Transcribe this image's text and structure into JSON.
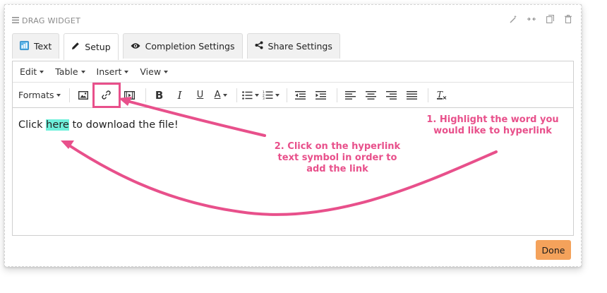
{
  "widget": {
    "title": "DRAG WIDGET",
    "actions": [
      "wand-icon",
      "collapse-icon",
      "copy-icon",
      "trash-icon"
    ]
  },
  "tabs": [
    {
      "label": "Text",
      "icon": "text-icon",
      "active": false
    },
    {
      "label": "Setup",
      "icon": "pencil-icon",
      "active": true
    },
    {
      "label": "Completion Settings",
      "icon": "eye-icon",
      "active": false
    },
    {
      "label": "Share Settings",
      "icon": "share-icon",
      "active": false
    }
  ],
  "editor": {
    "menus": [
      "Edit",
      "Table",
      "Insert",
      "View"
    ],
    "formats_label": "Formats",
    "content": {
      "before": "Click ",
      "highlight": "here",
      "after": " to download the file!"
    }
  },
  "annotations": {
    "step1": "1. Highlight the word you would like to hyperlink",
    "step2": "2. Click on the hyperlink text symbol in order to add the link"
  },
  "done_label": "Done",
  "colors": {
    "annotation": "#e8508b",
    "highlight": "#6ff0db",
    "done_button": "#f4a25b"
  }
}
